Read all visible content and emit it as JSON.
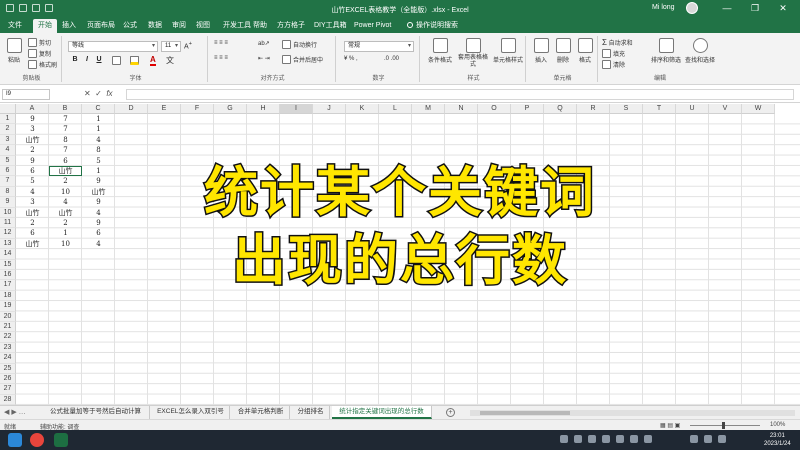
{
  "title_bar": {
    "document_title": "山竹EXCEL表格教学（全能版）.xlsx - Excel",
    "user_name": "Mi long",
    "minimize": "—",
    "restore": "❐",
    "close": "✕"
  },
  "ribbon_tabs": [
    "文件",
    "开始",
    "插入",
    "页面布局",
    "公式",
    "数据",
    "审阅",
    "视图",
    "开发工具",
    "帮助",
    "方方格子",
    "DIY工具箱",
    "Power Pivot"
  ],
  "active_tab": "开始",
  "tell_me": "操作说明搜索",
  "ribbon": {
    "clipboard": {
      "label": "剪贴板",
      "paste": "粘贴",
      "cut": "剪切",
      "copy": "复制",
      "format_painter": "格式刷"
    },
    "font": {
      "label": "字体",
      "font_name": "等线",
      "font_size": "11",
      "bold": "B",
      "italic": "I",
      "underline": "U"
    },
    "alignment": {
      "label": "对齐方式",
      "wrap": "自动换行",
      "merge": "合并后居中"
    },
    "number": {
      "label": "数字",
      "format": "常规"
    },
    "styles": {
      "label": "样式",
      "conditional": "条件格式",
      "table": "套用表格格式",
      "cell_styles": "单元格样式"
    },
    "cells": {
      "label": "单元格",
      "insert": "插入",
      "delete": "删除",
      "format": "格式"
    },
    "editing": {
      "label": "编辑",
      "autosum": "自动求和",
      "fill": "填充",
      "clear": "清除",
      "sort": "排序和筛选",
      "find": "查找和选择"
    }
  },
  "formula_bar": {
    "name_box": "I9",
    "fx": "fx",
    "formula": ""
  },
  "columns": [
    "A",
    "B",
    "C",
    "D",
    "E",
    "F",
    "G",
    "H",
    "I",
    "J",
    "K",
    "L",
    "M",
    "N",
    "O",
    "P",
    "Q",
    "R",
    "S",
    "T",
    "U",
    "V",
    "W"
  ],
  "selected_column": "I",
  "rows": [
    "1",
    "2",
    "3",
    "4",
    "5",
    "6",
    "7",
    "8",
    "9",
    "10",
    "11",
    "12",
    "13",
    "14",
    "15",
    "16",
    "17",
    "18",
    "19",
    "20",
    "21",
    "22",
    "23",
    "24",
    "25",
    "26",
    "27",
    "28"
  ],
  "data": [
    [
      "9",
      "7",
      "1"
    ],
    [
      "3",
      "7",
      "1"
    ],
    [
      "山竹",
      "8",
      "4"
    ],
    [
      "2",
      "7",
      "8"
    ],
    [
      "9",
      "6",
      "5"
    ],
    [
      "6",
      "山竹",
      "1"
    ],
    [
      "5",
      "2",
      "9"
    ],
    [
      "4",
      "10",
      "山竹"
    ],
    [
      "3",
      "4",
      "9"
    ],
    [
      "山竹",
      "山竹",
      "4"
    ],
    [
      "2",
      "2",
      "9"
    ],
    [
      "6",
      "1",
      "6"
    ],
    [
      "山竹",
      "10",
      "4"
    ]
  ],
  "caption": {
    "line1": "统计某个关键词",
    "line2": "出现的总行数"
  },
  "sheet_tabs": [
    "公式批量加等于号然后自动计算",
    "EXCEL怎么录入双引号",
    "合并单元格判断",
    "分组排名",
    "统计指定关键词出现的总行数"
  ],
  "active_sheet": "统计指定关键词出现的总行数",
  "status_bar": {
    "ready": "就绪",
    "accessibility": "辅助功能: 调查",
    "zoom": "100%"
  },
  "taskbar": {
    "time": "23:01",
    "date": "2023/1/24"
  }
}
